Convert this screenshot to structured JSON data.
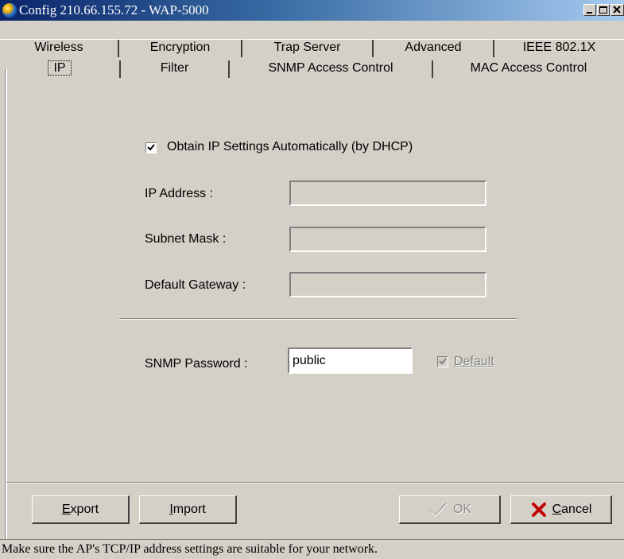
{
  "window": {
    "title": "Config 210.66.155.72 - WAP-5000"
  },
  "tabs": {
    "row1": [
      {
        "label": "Wireless"
      },
      {
        "label": "Encryption"
      },
      {
        "label": "Trap Server"
      },
      {
        "label": "Advanced"
      },
      {
        "label": "IEEE 802.1X"
      }
    ],
    "row2": [
      {
        "label": "IP",
        "active": true
      },
      {
        "label": "Filter"
      },
      {
        "label": "SNMP Access Control"
      },
      {
        "label": "MAC Access Control"
      }
    ]
  },
  "ip_settings": {
    "dhcp_label": "Obtain IP Settings Automatically (by DHCP)",
    "dhcp_checked": true,
    "ip_address_label": "IP Address :",
    "ip_address_value": "",
    "subnet_mask_label": "Subnet Mask :",
    "subnet_mask_value": "",
    "gateway_label": "Default Gateway :",
    "gateway_value": "",
    "snmp_password_label": "SNMP Password :",
    "snmp_password_value": "public",
    "default_label": "Default",
    "default_checked": true
  },
  "buttons": {
    "export_mnemonic": "E",
    "export_rest": "xport",
    "import_mnemonic": "I",
    "import_rest": "mport",
    "ok": "OK",
    "cancel_mnemonic": "C",
    "cancel_rest": "ancel"
  },
  "status": {
    "text": "Make sure the AP's TCP/IP address settings are suitable for your network."
  }
}
